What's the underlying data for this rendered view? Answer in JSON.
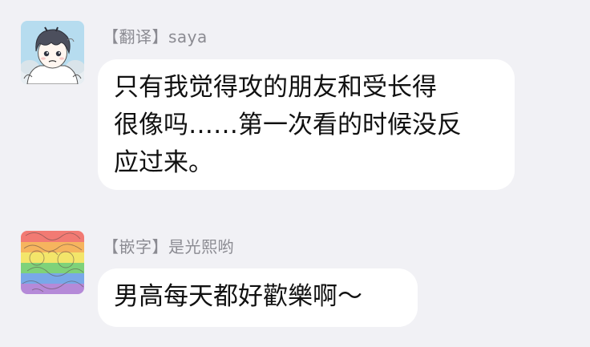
{
  "messages": [
    {
      "sender": "【翻译】saya",
      "avatar_icon": "anime-boy-avatar-icon",
      "text_lines": [
        "只有我觉得攻的朋友和受长得",
        "很像吗……第一次看的时候没反",
        "应过来。"
      ]
    },
    {
      "sender": "【嵌字】是光熙哟",
      "avatar_icon": "rainbow-sketch-avatar-icon",
      "text_lines": [
        "男高每天都好歡樂啊～"
      ]
    }
  ],
  "colors": {
    "background": "#f1f1f5",
    "bubble": "#ffffff",
    "sender_text": "#8b8b92",
    "message_text": "#111111"
  }
}
